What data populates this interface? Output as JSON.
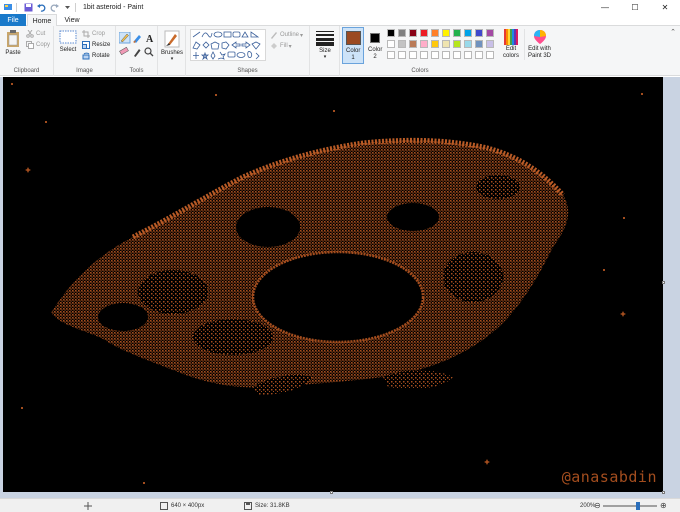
{
  "window": {
    "title": "1bit asteroid - Paint",
    "controls": [
      "—",
      "☐",
      "✕"
    ]
  },
  "tabs": {
    "file": "File",
    "home": "Home",
    "view": "View"
  },
  "ribbon": {
    "clipboard": {
      "group": "Clipboard",
      "paste": "Paste",
      "cut": "Cut",
      "copy": "Copy"
    },
    "image": {
      "group": "Image",
      "select": "Select",
      "crop": "Crop",
      "resize": "Resize",
      "rotate": "Rotate"
    },
    "tools": {
      "group": "Tools"
    },
    "brushes": {
      "label": "Brushes"
    },
    "shapes": {
      "group": "Shapes",
      "outline": "Outline",
      "fill": "Fill"
    },
    "size": {
      "label": "Size"
    },
    "colors": {
      "group": "Colors",
      "color1": "Color 1",
      "color2": "Color 2",
      "color1_value": "#9b4a22",
      "color2_value": "#000000",
      "edit_colors": "Edit colors",
      "edit_paint3d": "Edit with Paint 3D",
      "palette": [
        "#000000",
        "#7f7f7f",
        "#880015",
        "#ed1c24",
        "#ff7f27",
        "#fff200",
        "#22b14c",
        "#00a2e8",
        "#3f48cc",
        "#a349a4",
        "#ffffff",
        "#c3c3c3",
        "#b97a57",
        "#ffaec9",
        "#ffc90e",
        "#efe4b0",
        "#b5e61d",
        "#99d9ea",
        "#7092be",
        "#c8bfe7",
        "#ffffff",
        "#ffffff",
        "#ffffff",
        "#ffffff",
        "#ffffff",
        "#ffffff",
        "#ffffff",
        "#ffffff",
        "#ffffff",
        "#ffffff"
      ]
    }
  },
  "canvas": {
    "watermark": "@anasabdin",
    "asteroid_color": "#a34d1e"
  },
  "status": {
    "dimensions": "640 × 400px",
    "size": "Size: 31.8KB",
    "zoom": "200%"
  }
}
